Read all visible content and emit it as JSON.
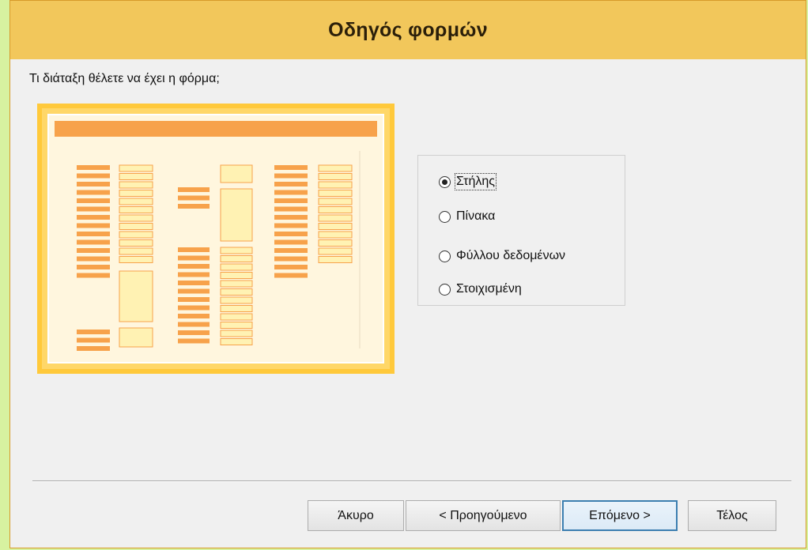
{
  "window": {
    "title": "Οδηγός φορμών"
  },
  "question": "Τι διάταξη θέλετε να έχει η φόρμα;",
  "layout_options": [
    {
      "label": "Στήλης",
      "selected": true
    },
    {
      "label": "Πίνακα",
      "selected": false
    },
    {
      "label": "Φύλλου δεδομένων",
      "selected": false
    },
    {
      "label": "Στοιχισμένη",
      "selected": false
    }
  ],
  "buttons": {
    "cancel": "Άκυρο",
    "back": "< Προηγούμενο",
    "next": "Επόμενο >",
    "finish": "Τέλος"
  },
  "colors": {
    "accent": "#f2c75b",
    "preview_orange": "#f7a24b",
    "preview_frame": "#ffc93b",
    "background": "#d7f2a0"
  }
}
